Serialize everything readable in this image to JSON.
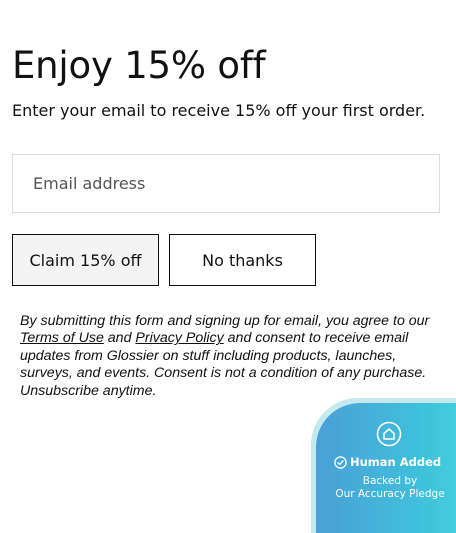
{
  "modal": {
    "title": "Enjoy 15% off",
    "subtitle": "Enter your email to receive 15% off your first order."
  },
  "form": {
    "email_placeholder": "Email address",
    "email_value": "",
    "claim_label": "Claim 15% off",
    "no_thanks_label": "No thanks"
  },
  "disclaimer": {
    "part1": "By submitting this form and signing up for email, you agree to our ",
    "terms_link": "Terms of Use",
    "part2": " and ",
    "privacy_link": "Privacy Policy",
    "part3": " and consent to receive email updates from Glossier on stuff including products, launches, surveys, and events. Consent is not a condition of any purchase. Unsubscribe anytime."
  },
  "badge": {
    "title": "Human Added",
    "line1": "Backed by",
    "line2": "Our Accuracy Pledge",
    "icons": [
      "home-icon",
      "check-circle-icon"
    ],
    "colors": {
      "gradient_start": "#4a9fd6",
      "gradient_end": "#48d6dc",
      "border": "#c4e9ee",
      "text": "#ffffff"
    }
  },
  "colors": {
    "text": "#111111",
    "claim_button_bg": "#f4f4f4",
    "input_border": "#dcdcdc",
    "background": "#ffffff"
  }
}
